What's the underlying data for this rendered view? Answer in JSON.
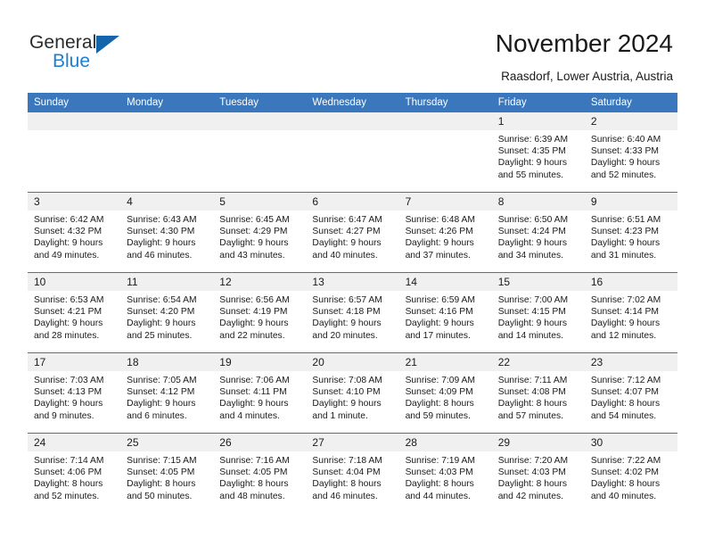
{
  "logo": {
    "word_one": "General",
    "word_two": "Blue",
    "triangle": "blue-triangle-icon"
  },
  "header": {
    "title": "November 2024",
    "location": "Raasdorf, Lower Austria, Austria"
  },
  "colors": {
    "header_blue": "#3b77bc",
    "logo_blue": "#1b7fd4",
    "logo_triangle": "#1565ab",
    "daynum_band": "#f0f0f0",
    "text": "#1a1a1a"
  },
  "weekday_headers": [
    "Sunday",
    "Monday",
    "Tuesday",
    "Wednesday",
    "Thursday",
    "Friday",
    "Saturday"
  ],
  "weeks": [
    [
      {
        "day": "",
        "empty": true,
        "sunrise": "",
        "sunset": "",
        "daylight_line1": "",
        "daylight_line2": ""
      },
      {
        "day": "",
        "empty": true,
        "sunrise": "",
        "sunset": "",
        "daylight_line1": "",
        "daylight_line2": ""
      },
      {
        "day": "",
        "empty": true,
        "sunrise": "",
        "sunset": "",
        "daylight_line1": "",
        "daylight_line2": ""
      },
      {
        "day": "",
        "empty": true,
        "sunrise": "",
        "sunset": "",
        "daylight_line1": "",
        "daylight_line2": ""
      },
      {
        "day": "",
        "empty": true,
        "sunrise": "",
        "sunset": "",
        "daylight_line1": "",
        "daylight_line2": ""
      },
      {
        "day": "1",
        "empty": false,
        "sunrise": "Sunrise: 6:39 AM",
        "sunset": "Sunset: 4:35 PM",
        "daylight_line1": "Daylight: 9 hours",
        "daylight_line2": "and 55 minutes."
      },
      {
        "day": "2",
        "empty": false,
        "sunrise": "Sunrise: 6:40 AM",
        "sunset": "Sunset: 4:33 PM",
        "daylight_line1": "Daylight: 9 hours",
        "daylight_line2": "and 52 minutes."
      }
    ],
    [
      {
        "day": "3",
        "empty": false,
        "sunrise": "Sunrise: 6:42 AM",
        "sunset": "Sunset: 4:32 PM",
        "daylight_line1": "Daylight: 9 hours",
        "daylight_line2": "and 49 minutes."
      },
      {
        "day": "4",
        "empty": false,
        "sunrise": "Sunrise: 6:43 AM",
        "sunset": "Sunset: 4:30 PM",
        "daylight_line1": "Daylight: 9 hours",
        "daylight_line2": "and 46 minutes."
      },
      {
        "day": "5",
        "empty": false,
        "sunrise": "Sunrise: 6:45 AM",
        "sunset": "Sunset: 4:29 PM",
        "daylight_line1": "Daylight: 9 hours",
        "daylight_line2": "and 43 minutes."
      },
      {
        "day": "6",
        "empty": false,
        "sunrise": "Sunrise: 6:47 AM",
        "sunset": "Sunset: 4:27 PM",
        "daylight_line1": "Daylight: 9 hours",
        "daylight_line2": "and 40 minutes."
      },
      {
        "day": "7",
        "empty": false,
        "sunrise": "Sunrise: 6:48 AM",
        "sunset": "Sunset: 4:26 PM",
        "daylight_line1": "Daylight: 9 hours",
        "daylight_line2": "and 37 minutes."
      },
      {
        "day": "8",
        "empty": false,
        "sunrise": "Sunrise: 6:50 AM",
        "sunset": "Sunset: 4:24 PM",
        "daylight_line1": "Daylight: 9 hours",
        "daylight_line2": "and 34 minutes."
      },
      {
        "day": "9",
        "empty": false,
        "sunrise": "Sunrise: 6:51 AM",
        "sunset": "Sunset: 4:23 PM",
        "daylight_line1": "Daylight: 9 hours",
        "daylight_line2": "and 31 minutes."
      }
    ],
    [
      {
        "day": "10",
        "empty": false,
        "sunrise": "Sunrise: 6:53 AM",
        "sunset": "Sunset: 4:21 PM",
        "daylight_line1": "Daylight: 9 hours",
        "daylight_line2": "and 28 minutes."
      },
      {
        "day": "11",
        "empty": false,
        "sunrise": "Sunrise: 6:54 AM",
        "sunset": "Sunset: 4:20 PM",
        "daylight_line1": "Daylight: 9 hours",
        "daylight_line2": "and 25 minutes."
      },
      {
        "day": "12",
        "empty": false,
        "sunrise": "Sunrise: 6:56 AM",
        "sunset": "Sunset: 4:19 PM",
        "daylight_line1": "Daylight: 9 hours",
        "daylight_line2": "and 22 minutes."
      },
      {
        "day": "13",
        "empty": false,
        "sunrise": "Sunrise: 6:57 AM",
        "sunset": "Sunset: 4:18 PM",
        "daylight_line1": "Daylight: 9 hours",
        "daylight_line2": "and 20 minutes."
      },
      {
        "day": "14",
        "empty": false,
        "sunrise": "Sunrise: 6:59 AM",
        "sunset": "Sunset: 4:16 PM",
        "daylight_line1": "Daylight: 9 hours",
        "daylight_line2": "and 17 minutes."
      },
      {
        "day": "15",
        "empty": false,
        "sunrise": "Sunrise: 7:00 AM",
        "sunset": "Sunset: 4:15 PM",
        "daylight_line1": "Daylight: 9 hours",
        "daylight_line2": "and 14 minutes."
      },
      {
        "day": "16",
        "empty": false,
        "sunrise": "Sunrise: 7:02 AM",
        "sunset": "Sunset: 4:14 PM",
        "daylight_line1": "Daylight: 9 hours",
        "daylight_line2": "and 12 minutes."
      }
    ],
    [
      {
        "day": "17",
        "empty": false,
        "sunrise": "Sunrise: 7:03 AM",
        "sunset": "Sunset: 4:13 PM",
        "daylight_line1": "Daylight: 9 hours",
        "daylight_line2": "and 9 minutes."
      },
      {
        "day": "18",
        "empty": false,
        "sunrise": "Sunrise: 7:05 AM",
        "sunset": "Sunset: 4:12 PM",
        "daylight_line1": "Daylight: 9 hours",
        "daylight_line2": "and 6 minutes."
      },
      {
        "day": "19",
        "empty": false,
        "sunrise": "Sunrise: 7:06 AM",
        "sunset": "Sunset: 4:11 PM",
        "daylight_line1": "Daylight: 9 hours",
        "daylight_line2": "and 4 minutes."
      },
      {
        "day": "20",
        "empty": false,
        "sunrise": "Sunrise: 7:08 AM",
        "sunset": "Sunset: 4:10 PM",
        "daylight_line1": "Daylight: 9 hours",
        "daylight_line2": "and 1 minute."
      },
      {
        "day": "21",
        "empty": false,
        "sunrise": "Sunrise: 7:09 AM",
        "sunset": "Sunset: 4:09 PM",
        "daylight_line1": "Daylight: 8 hours",
        "daylight_line2": "and 59 minutes."
      },
      {
        "day": "22",
        "empty": false,
        "sunrise": "Sunrise: 7:11 AM",
        "sunset": "Sunset: 4:08 PM",
        "daylight_line1": "Daylight: 8 hours",
        "daylight_line2": "and 57 minutes."
      },
      {
        "day": "23",
        "empty": false,
        "sunrise": "Sunrise: 7:12 AM",
        "sunset": "Sunset: 4:07 PM",
        "daylight_line1": "Daylight: 8 hours",
        "daylight_line2": "and 54 minutes."
      }
    ],
    [
      {
        "day": "24",
        "empty": false,
        "sunrise": "Sunrise: 7:14 AM",
        "sunset": "Sunset: 4:06 PM",
        "daylight_line1": "Daylight: 8 hours",
        "daylight_line2": "and 52 minutes."
      },
      {
        "day": "25",
        "empty": false,
        "sunrise": "Sunrise: 7:15 AM",
        "sunset": "Sunset: 4:05 PM",
        "daylight_line1": "Daylight: 8 hours",
        "daylight_line2": "and 50 minutes."
      },
      {
        "day": "26",
        "empty": false,
        "sunrise": "Sunrise: 7:16 AM",
        "sunset": "Sunset: 4:05 PM",
        "daylight_line1": "Daylight: 8 hours",
        "daylight_line2": "and 48 minutes."
      },
      {
        "day": "27",
        "empty": false,
        "sunrise": "Sunrise: 7:18 AM",
        "sunset": "Sunset: 4:04 PM",
        "daylight_line1": "Daylight: 8 hours",
        "daylight_line2": "and 46 minutes."
      },
      {
        "day": "28",
        "empty": false,
        "sunrise": "Sunrise: 7:19 AM",
        "sunset": "Sunset: 4:03 PM",
        "daylight_line1": "Daylight: 8 hours",
        "daylight_line2": "and 44 minutes."
      },
      {
        "day": "29",
        "empty": false,
        "sunrise": "Sunrise: 7:20 AM",
        "sunset": "Sunset: 4:03 PM",
        "daylight_line1": "Daylight: 8 hours",
        "daylight_line2": "and 42 minutes."
      },
      {
        "day": "30",
        "empty": false,
        "sunrise": "Sunrise: 7:22 AM",
        "sunset": "Sunset: 4:02 PM",
        "daylight_line1": "Daylight: 8 hours",
        "daylight_line2": "and 40 minutes."
      }
    ]
  ]
}
